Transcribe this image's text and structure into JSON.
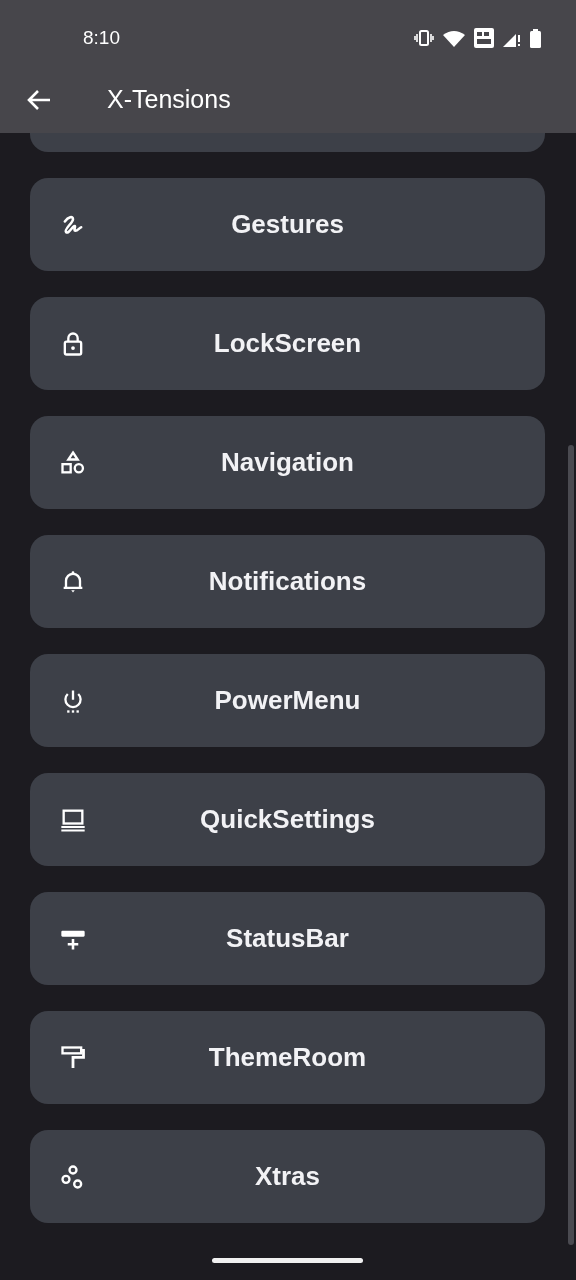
{
  "status_bar": {
    "time": "8:10"
  },
  "app_bar": {
    "title": "X-Tensions"
  },
  "items": [
    {
      "label": "Gestures",
      "kind": "gestures"
    },
    {
      "label": "LockScreen",
      "kind": "lock"
    },
    {
      "label": "Navigation",
      "kind": "shapes"
    },
    {
      "label": "Notifications",
      "kind": "bell"
    },
    {
      "label": "PowerMenu",
      "kind": "power"
    },
    {
      "label": "QuickSettings",
      "kind": "laptop"
    },
    {
      "label": "StatusBar",
      "kind": "statusbar"
    },
    {
      "label": "ThemeRoom",
      "kind": "roller"
    },
    {
      "label": "Xtras",
      "kind": "circles"
    }
  ]
}
